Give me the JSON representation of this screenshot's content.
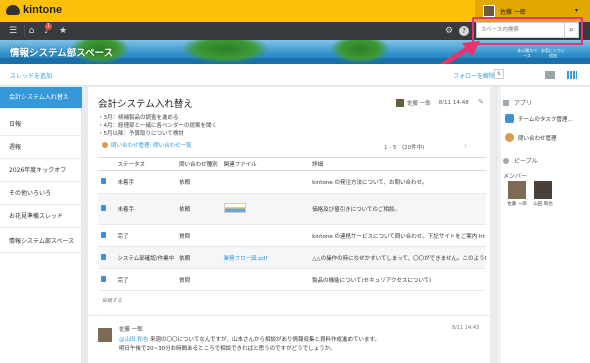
{
  "app": {
    "logo_text": "kintone",
    "brand_color": "#fcc00a"
  },
  "user": {
    "name": "佐藤 一郎"
  },
  "nav": {
    "notification_count": "1",
    "icons": [
      "menu-icon",
      "home-icon",
      "bell-icon",
      "star-icon",
      "gear-icon",
      "help-icon"
    ]
  },
  "space": {
    "title": "情報システム部スペース"
  },
  "search": {
    "placeholder": "スペース内検索"
  },
  "space_buttons": {
    "space_label": "本公開スペース",
    "favorite_label": "お気に入りに追加"
  },
  "toolbar": {
    "add_thread": "スレッドを追加",
    "follow": "フォローを解除"
  },
  "sidebar": {
    "items": [
      {
        "label": "会計システム入れ替え",
        "active": true
      },
      {
        "label": "日報"
      },
      {
        "label": "週報"
      },
      {
        "label": "2026年度キックオフ"
      },
      {
        "label": "その他いろいろ"
      },
      {
        "label": "お花見準備スレッド"
      },
      {
        "label": "情報システム部スペース"
      }
    ]
  },
  "thread": {
    "title": "会計システム入れ替え",
    "author": "佐藤 一郎",
    "date": "8/11 14:48",
    "bullets": [
      "・3月：候補製品の調査を進める",
      "・4月：経理部と一緒に各ベンダーの提案を聞く",
      "・5月以降：予算取りについて検討"
    ],
    "app_link": "問い合わせ管理: 問い合わせ一覧",
    "pager": "1 - 5　(20件中)"
  },
  "table": {
    "headers": [
      "",
      "ステータス",
      "問い合わせ種別",
      "関連ファイル",
      "詳細"
    ],
    "rows": [
      {
        "status": "未着手",
        "type": "依頼",
        "file": "",
        "detail": "kintone の発注方法について、お問い合わせ。"
      },
      {
        "status": "未着手",
        "type": "依頼",
        "file": "[thumbnail]",
        "detail": "価格及び値引きについてのご相談。"
      },
      {
        "status": "完了",
        "type": "質問",
        "file": "",
        "detail": "kintone の連携サービスについて問い合わせ。下記サイトをご案内 ht"
      },
      {
        "status": "システム部確認/作業中",
        "type": "依頼",
        "file": "業務フロー図.pdf",
        "detail": "△△の操作の時になぜかすいてしまって、〇〇ができません。このようl"
      },
      {
        "status": "完了",
        "type": "質問",
        "file": "",
        "detail": "製品の機能について(セキュリアクセスについて)"
      }
    ]
  },
  "post_hint": "投稿する",
  "comment": {
    "author": "佐藤 一郎",
    "date": "8/11 14:43",
    "mention": "@山田 和也",
    "line1": " 来週の〇〇についてなんですが、山本さんから相談があり情報収集と資料作成進めています。",
    "line2": "明日午後で20~30分お時間あるところで相談できればと思うのですがどうでしょうか。"
  },
  "rpanel": {
    "apps_header": "アプリ",
    "apps": [
      {
        "name": "チームのタスク管理...",
        "color": "#3f8fd6"
      },
      {
        "name": "問い合わせ管理",
        "color": "#d99a4b"
      }
    ],
    "people_header": "ピープル",
    "members_header": "メンバー",
    "members": [
      "佐藤 一郎",
      "山田 和也"
    ]
  }
}
